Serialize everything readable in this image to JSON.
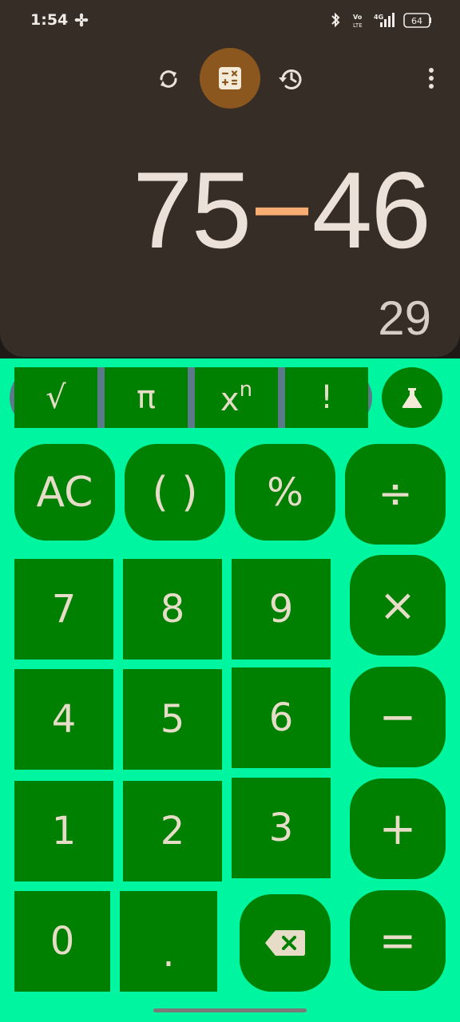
{
  "status_bar": {
    "time": "1:54",
    "signal_labels": [
      "Vo",
      "LTE",
      "4G"
    ],
    "battery": "64"
  },
  "toolbar": {
    "icons": [
      "refresh-icon",
      "calculator-icon",
      "history-icon",
      "more-vert-icon"
    ],
    "active_color": "#8c571f"
  },
  "display": {
    "operand_a": "75",
    "operator": "−",
    "operand_b": "46",
    "result": "29",
    "operator_color": "#f9ad73"
  },
  "scientific": {
    "sqrt": "√",
    "pi": "π",
    "power_base": "x",
    "power_exp": "n",
    "factorial": "!"
  },
  "keys": {
    "ac": "AC",
    "parens": "( )",
    "percent": "%",
    "divide": "÷",
    "seven": "7",
    "eight": "8",
    "nine": "9",
    "multiply": "×",
    "four": "4",
    "five": "5",
    "six": "6",
    "minus": "−",
    "one": "1",
    "two": "2",
    "three": "3",
    "plus": "+",
    "zero": "0",
    "decimal": ".",
    "equals": "="
  },
  "colors": {
    "keypad_background": "#00f5a0",
    "key": "#008000",
    "key_text": "#e6dcc8",
    "display_panel": "#362d27"
  }
}
